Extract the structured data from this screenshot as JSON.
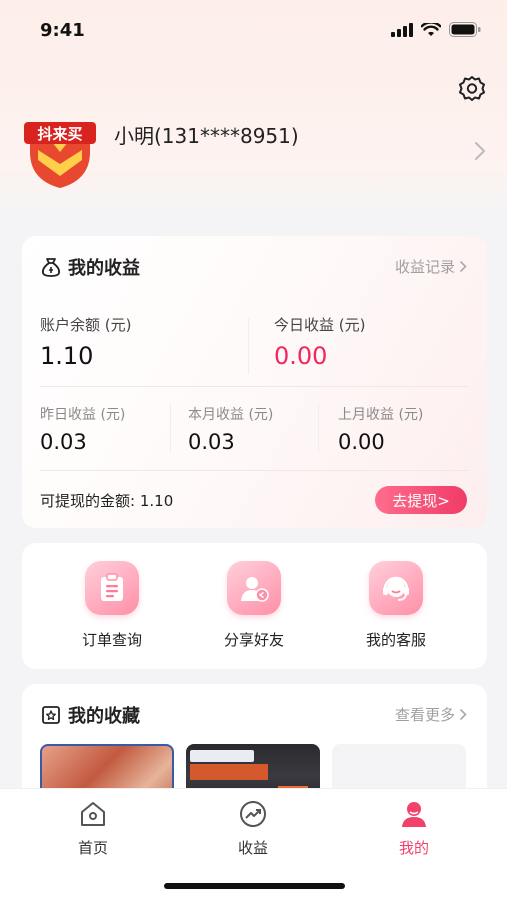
{
  "status_bar": {
    "time": "9:41"
  },
  "header": {
    "username": "小明(131****8951)",
    "logo_text": "抖来买"
  },
  "earnings": {
    "title": "我的收益",
    "link": "收益记录",
    "balance_label": "账户余额 (元)",
    "balance_value": "1.10",
    "today_label": "今日收益 (元)",
    "today_value": "0.00",
    "yesterday_label": "昨日收益 (元)",
    "yesterday_value": "0.03",
    "month_label": "本月收益 (元)",
    "month_value": "0.03",
    "last_month_label": "上月收益 (元)",
    "last_month_value": "0.00",
    "withdrawable_label": "可提现的金额:",
    "withdrawable_value": "1.10",
    "withdraw_button": "去提现>"
  },
  "actions": [
    {
      "label": "订单查询",
      "icon": "order-icon"
    },
    {
      "label": "分享好友",
      "icon": "share-icon"
    },
    {
      "label": "我的客服",
      "icon": "headset-icon"
    }
  ],
  "favorites": {
    "title": "我的收藏",
    "link": "查看更多"
  },
  "tabs": [
    {
      "label": "首页",
      "icon": "home-icon",
      "active": false
    },
    {
      "label": "收益",
      "icon": "trend-icon",
      "active": false
    },
    {
      "label": "我的",
      "icon": "user-icon",
      "active": true
    }
  ],
  "colors": {
    "accent": "#f2426c",
    "today_value": "#f0285c",
    "muted": "#a0a0a0"
  }
}
